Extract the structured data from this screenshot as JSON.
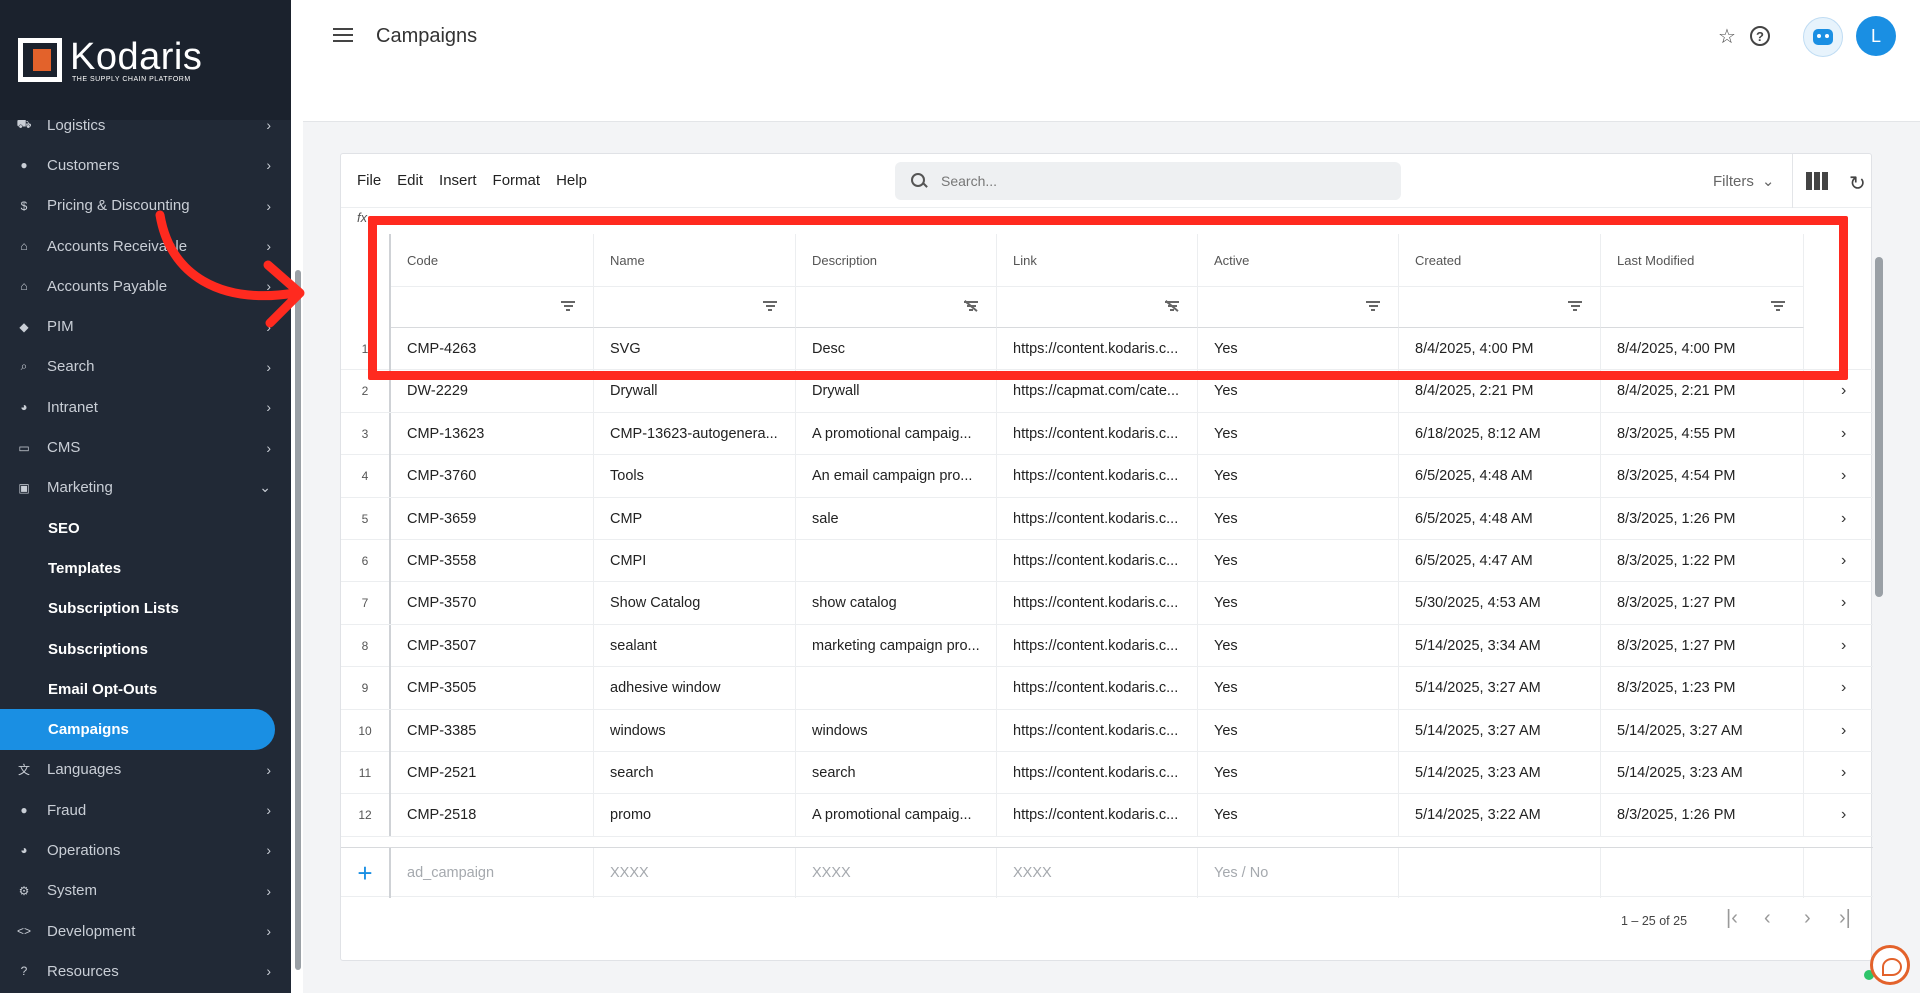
{
  "brand": {
    "name": "Kodaris",
    "tagline": "THE SUPPLY CHAIN PLATFORM",
    "accent": "#1a8fe3",
    "logo_color": "#e3622b"
  },
  "sidebar": {
    "items": [
      {
        "label": "Logistics",
        "icon": "truck-icon",
        "glyph": "⛟"
      },
      {
        "label": "Customers",
        "icon": "people-icon",
        "glyph": "●"
      },
      {
        "label": "Pricing & Discounting",
        "icon": "dollar-icon",
        "glyph": "$"
      },
      {
        "label": "Accounts Receivable",
        "icon": "bank-icon",
        "glyph": "⌂"
      },
      {
        "label": "Accounts Payable",
        "icon": "bank-icon",
        "glyph": "⌂"
      },
      {
        "label": "PIM",
        "icon": "tag-icon",
        "glyph": "◆"
      },
      {
        "label": "Search",
        "icon": "search-icon",
        "glyph": "⌕"
      },
      {
        "label": "Intranet",
        "icon": "globe-icon",
        "glyph": "◕"
      },
      {
        "label": "CMS",
        "icon": "browser-icon",
        "glyph": "▭"
      },
      {
        "label": "Marketing",
        "icon": "campaign-icon",
        "glyph": "▣"
      }
    ],
    "marketing_sub": [
      {
        "label": "SEO"
      },
      {
        "label": "Templates"
      },
      {
        "label": "Subscription Lists"
      },
      {
        "label": "Subscriptions"
      },
      {
        "label": "Email Opt-Outs"
      },
      {
        "label": "Campaigns"
      }
    ],
    "items_after": [
      {
        "label": "Languages",
        "icon": "translate-icon",
        "glyph": "文"
      },
      {
        "label": "Fraud",
        "icon": "alert-icon",
        "glyph": "●"
      },
      {
        "label": "Operations",
        "icon": "operations-icon",
        "glyph": "◕"
      },
      {
        "label": "System",
        "icon": "gear-icon",
        "glyph": "⚙"
      },
      {
        "label": "Development",
        "icon": "code-icon",
        "glyph": "<>"
      },
      {
        "label": "Resources",
        "icon": "help-icon",
        "glyph": "?"
      }
    ]
  },
  "header": {
    "title": "Campaigns",
    "avatar_initial": "L"
  },
  "toolbar": {
    "menu": [
      "File",
      "Edit",
      "Insert",
      "Format",
      "Help"
    ],
    "search_placeholder": "Search...",
    "filters_label": "Filters",
    "fx_label": "fx"
  },
  "table": {
    "columns": [
      "Code",
      "Name",
      "Description",
      "Link",
      "Active",
      "Created",
      "Last Modified"
    ],
    "rows": [
      {
        "n": "1",
        "code": "CMP-4263",
        "name": "SVG",
        "desc": "Desc",
        "link": "https://content.kodaris.c...",
        "active": "Yes",
        "created": "8/4/2025, 4:00 PM",
        "modified": "8/4/2025, 4:00 PM"
      },
      {
        "n": "2",
        "code": "DW-2229",
        "name": "Drywall",
        "desc": "Drywall",
        "link": "https://capmat.com/cate...",
        "active": "Yes",
        "created": "8/4/2025, 2:21 PM",
        "modified": "8/4/2025, 2:21 PM"
      },
      {
        "n": "3",
        "code": "CMP-13623",
        "name": "CMP-13623-autogenera...",
        "desc": "A promotional campaig...",
        "link": "https://content.kodaris.c...",
        "active": "Yes",
        "created": "6/18/2025, 8:12 AM",
        "modified": "8/3/2025, 4:55 PM"
      },
      {
        "n": "4",
        "code": "CMP-3760",
        "name": "Tools",
        "desc": "An email campaign pro...",
        "link": "https://content.kodaris.c...",
        "active": "Yes",
        "created": "6/5/2025, 4:48 AM",
        "modified": "8/3/2025, 4:54 PM"
      },
      {
        "n": "5",
        "code": "CMP-3659",
        "name": "CMP",
        "desc": "sale",
        "link": "https://content.kodaris.c...",
        "active": "Yes",
        "created": "6/5/2025, 4:48 AM",
        "modified": "8/3/2025, 1:26 PM"
      },
      {
        "n": "6",
        "code": "CMP-3558",
        "name": "CMPI",
        "desc": "",
        "link": "https://content.kodaris.c...",
        "active": "Yes",
        "created": "6/5/2025, 4:47 AM",
        "modified": "8/3/2025, 1:22 PM"
      },
      {
        "n": "7",
        "code": "CMP-3570",
        "name": "Show Catalog",
        "desc": "show catalog",
        "link": "https://content.kodaris.c...",
        "active": "Yes",
        "created": "5/30/2025, 4:53 AM",
        "modified": "8/3/2025, 1:27 PM"
      },
      {
        "n": "8",
        "code": "CMP-3507",
        "name": "sealant",
        "desc": "marketing campaign pro...",
        "link": "https://content.kodaris.c...",
        "active": "Yes",
        "created": "5/14/2025, 3:34 AM",
        "modified": "8/3/2025, 1:27 PM"
      },
      {
        "n": "9",
        "code": "CMP-3505",
        "name": "adhesive window",
        "desc": "",
        "link": "https://content.kodaris.c...",
        "active": "Yes",
        "created": "5/14/2025, 3:27 AM",
        "modified": "8/3/2025, 1:23 PM"
      },
      {
        "n": "10",
        "code": "CMP-3385",
        "name": "windows",
        "desc": "windows",
        "link": "https://content.kodaris.c...",
        "active": "Yes",
        "created": "5/14/2025, 3:27 AM",
        "modified": "5/14/2025, 3:27 AM"
      },
      {
        "n": "11",
        "code": "CMP-2521",
        "name": "search",
        "desc": "search",
        "link": "https://content.kodaris.c...",
        "active": "Yes",
        "created": "5/14/2025, 3:23 AM",
        "modified": "5/14/2025, 3:23 AM"
      },
      {
        "n": "12",
        "code": "CMP-2518",
        "name": "promo",
        "desc": "A promotional campaig...",
        "link": "https://content.kodaris.c...",
        "active": "Yes",
        "created": "5/14/2025, 3:22 AM",
        "modified": "8/3/2025, 1:26 PM"
      }
    ],
    "new_row": {
      "code": "ad_campaign",
      "name": "XXXX",
      "desc": "XXXX",
      "link": "XXXX",
      "active": "Yes / No"
    },
    "pager_text": "1 – 25 of 25"
  },
  "annotation": {
    "highlight_color": "#ff2a1f"
  }
}
